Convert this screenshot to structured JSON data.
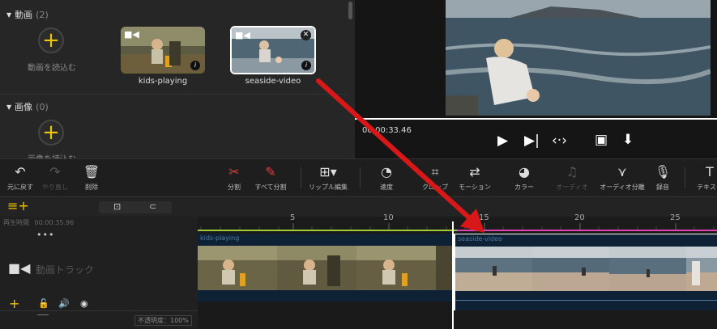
{
  "media": {
    "video_section": {
      "label": "動画",
      "count": "(2)"
    },
    "image_section": {
      "label": "画像",
      "count": "(0)"
    },
    "import_video_label": "動画を読込む",
    "import_image_label": "画像を読込む",
    "clips": [
      {
        "name": "kids-playing"
      },
      {
        "name": "seaside-video"
      }
    ]
  },
  "preview": {
    "timecode": "00:00:33.46"
  },
  "toolbar": {
    "undo": "元に戻す",
    "redo": "やり直し",
    "delete": "削除",
    "split": "分割",
    "split_all": "すべて分割",
    "ripple_edit": "リップル編集",
    "speed": "速度",
    "crop": "クロップ",
    "motion": "モーション",
    "color": "カラー",
    "audio": "オーディオ",
    "audio_split": "オーディオ分離",
    "record": "録音",
    "text": "テキスト"
  },
  "timeline": {
    "playback_time_label": "再生時間",
    "playback_time": "00:00:35.96",
    "ruler_ticks": [
      "5",
      "10",
      "15",
      "20",
      "25"
    ],
    "video_track_label": "動画トラック",
    "opacity": "不透明度：100%",
    "track_clips": [
      {
        "name": "kids-playing"
      },
      {
        "name": "seaside-video"
      }
    ]
  },
  "colors": {
    "accent": "#f2c500",
    "playhead": "#ffffff",
    "ruler_green": "#9ccc3c",
    "ruler_pink": "#e040b0",
    "arrow": "#d81818"
  }
}
